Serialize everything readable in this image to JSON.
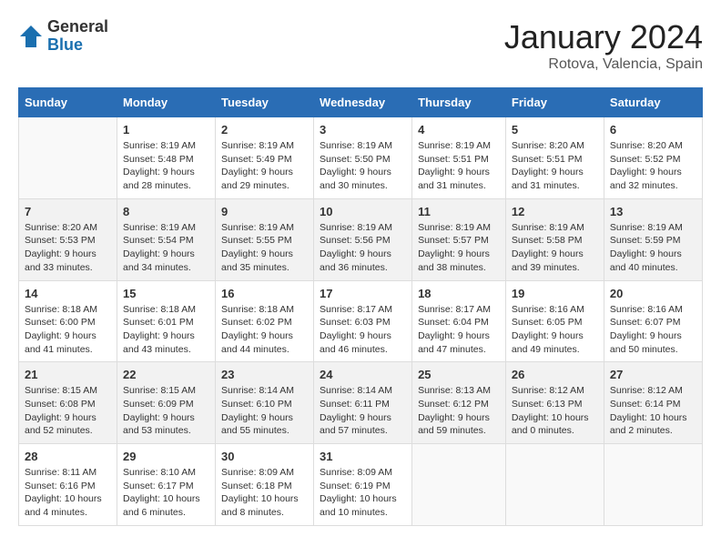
{
  "header": {
    "logo_general": "General",
    "logo_blue": "Blue",
    "month": "January 2024",
    "location": "Rotova, Valencia, Spain"
  },
  "days_of_week": [
    "Sunday",
    "Monday",
    "Tuesday",
    "Wednesday",
    "Thursday",
    "Friday",
    "Saturday"
  ],
  "weeks": [
    [
      {
        "day": "",
        "info": ""
      },
      {
        "day": "1",
        "info": "Sunrise: 8:19 AM\nSunset: 5:48 PM\nDaylight: 9 hours\nand 28 minutes."
      },
      {
        "day": "2",
        "info": "Sunrise: 8:19 AM\nSunset: 5:49 PM\nDaylight: 9 hours\nand 29 minutes."
      },
      {
        "day": "3",
        "info": "Sunrise: 8:19 AM\nSunset: 5:50 PM\nDaylight: 9 hours\nand 30 minutes."
      },
      {
        "day": "4",
        "info": "Sunrise: 8:19 AM\nSunset: 5:51 PM\nDaylight: 9 hours\nand 31 minutes."
      },
      {
        "day": "5",
        "info": "Sunrise: 8:20 AM\nSunset: 5:51 PM\nDaylight: 9 hours\nand 31 minutes."
      },
      {
        "day": "6",
        "info": "Sunrise: 8:20 AM\nSunset: 5:52 PM\nDaylight: 9 hours\nand 32 minutes."
      }
    ],
    [
      {
        "day": "7",
        "info": "Sunrise: 8:20 AM\nSunset: 5:53 PM\nDaylight: 9 hours\nand 33 minutes."
      },
      {
        "day": "8",
        "info": "Sunrise: 8:19 AM\nSunset: 5:54 PM\nDaylight: 9 hours\nand 34 minutes."
      },
      {
        "day": "9",
        "info": "Sunrise: 8:19 AM\nSunset: 5:55 PM\nDaylight: 9 hours\nand 35 minutes."
      },
      {
        "day": "10",
        "info": "Sunrise: 8:19 AM\nSunset: 5:56 PM\nDaylight: 9 hours\nand 36 minutes."
      },
      {
        "day": "11",
        "info": "Sunrise: 8:19 AM\nSunset: 5:57 PM\nDaylight: 9 hours\nand 38 minutes."
      },
      {
        "day": "12",
        "info": "Sunrise: 8:19 AM\nSunset: 5:58 PM\nDaylight: 9 hours\nand 39 minutes."
      },
      {
        "day": "13",
        "info": "Sunrise: 8:19 AM\nSunset: 5:59 PM\nDaylight: 9 hours\nand 40 minutes."
      }
    ],
    [
      {
        "day": "14",
        "info": "Sunrise: 8:18 AM\nSunset: 6:00 PM\nDaylight: 9 hours\nand 41 minutes."
      },
      {
        "day": "15",
        "info": "Sunrise: 8:18 AM\nSunset: 6:01 PM\nDaylight: 9 hours\nand 43 minutes."
      },
      {
        "day": "16",
        "info": "Sunrise: 8:18 AM\nSunset: 6:02 PM\nDaylight: 9 hours\nand 44 minutes."
      },
      {
        "day": "17",
        "info": "Sunrise: 8:17 AM\nSunset: 6:03 PM\nDaylight: 9 hours\nand 46 minutes."
      },
      {
        "day": "18",
        "info": "Sunrise: 8:17 AM\nSunset: 6:04 PM\nDaylight: 9 hours\nand 47 minutes."
      },
      {
        "day": "19",
        "info": "Sunrise: 8:16 AM\nSunset: 6:05 PM\nDaylight: 9 hours\nand 49 minutes."
      },
      {
        "day": "20",
        "info": "Sunrise: 8:16 AM\nSunset: 6:07 PM\nDaylight: 9 hours\nand 50 minutes."
      }
    ],
    [
      {
        "day": "21",
        "info": "Sunrise: 8:15 AM\nSunset: 6:08 PM\nDaylight: 9 hours\nand 52 minutes."
      },
      {
        "day": "22",
        "info": "Sunrise: 8:15 AM\nSunset: 6:09 PM\nDaylight: 9 hours\nand 53 minutes."
      },
      {
        "day": "23",
        "info": "Sunrise: 8:14 AM\nSunset: 6:10 PM\nDaylight: 9 hours\nand 55 minutes."
      },
      {
        "day": "24",
        "info": "Sunrise: 8:14 AM\nSunset: 6:11 PM\nDaylight: 9 hours\nand 57 minutes."
      },
      {
        "day": "25",
        "info": "Sunrise: 8:13 AM\nSunset: 6:12 PM\nDaylight: 9 hours\nand 59 minutes."
      },
      {
        "day": "26",
        "info": "Sunrise: 8:12 AM\nSunset: 6:13 PM\nDaylight: 10 hours\nand 0 minutes."
      },
      {
        "day": "27",
        "info": "Sunrise: 8:12 AM\nSunset: 6:14 PM\nDaylight: 10 hours\nand 2 minutes."
      }
    ],
    [
      {
        "day": "28",
        "info": "Sunrise: 8:11 AM\nSunset: 6:16 PM\nDaylight: 10 hours\nand 4 minutes."
      },
      {
        "day": "29",
        "info": "Sunrise: 8:10 AM\nSunset: 6:17 PM\nDaylight: 10 hours\nand 6 minutes."
      },
      {
        "day": "30",
        "info": "Sunrise: 8:09 AM\nSunset: 6:18 PM\nDaylight: 10 hours\nand 8 minutes."
      },
      {
        "day": "31",
        "info": "Sunrise: 8:09 AM\nSunset: 6:19 PM\nDaylight: 10 hours\nand 10 minutes."
      },
      {
        "day": "",
        "info": ""
      },
      {
        "day": "",
        "info": ""
      },
      {
        "day": "",
        "info": ""
      }
    ]
  ]
}
